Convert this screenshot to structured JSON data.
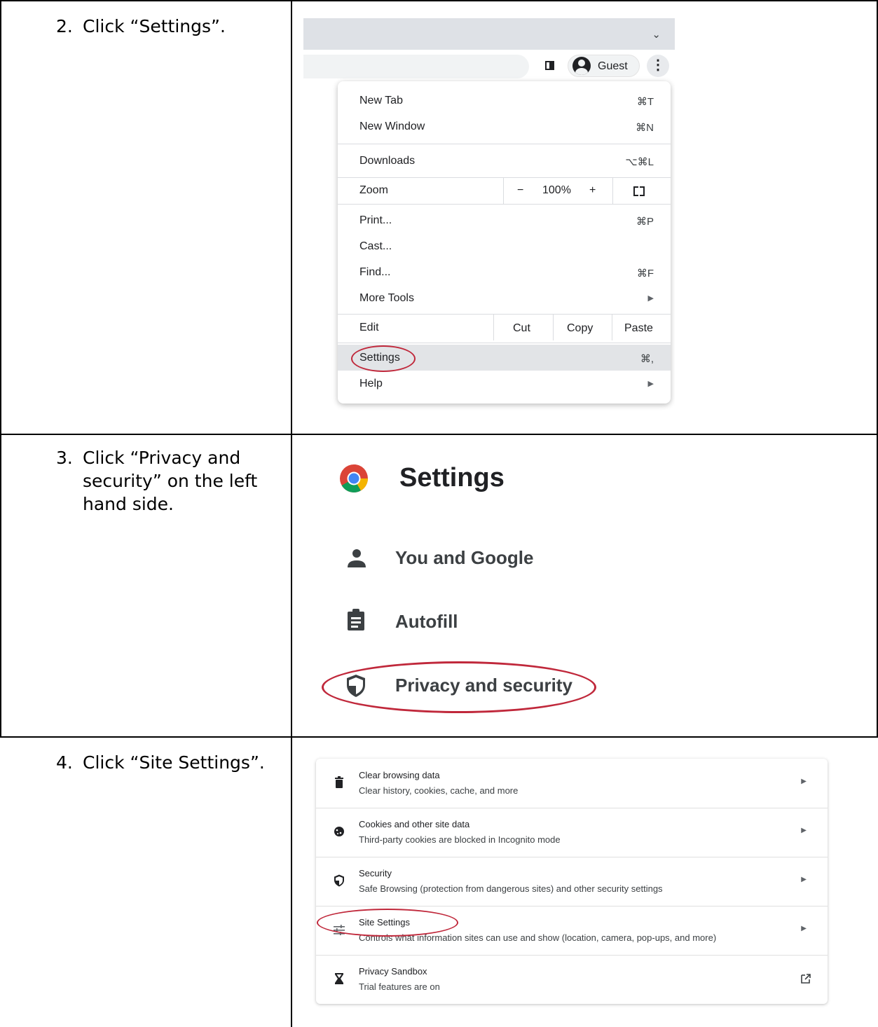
{
  "steps": [
    {
      "number": "2.",
      "text": "Click “Settings”."
    },
    {
      "number": "3.",
      "text": "Click “Privacy and security” on the left hand side."
    },
    {
      "number": "4.",
      "text": "Click “Site Settings”."
    }
  ],
  "chrome": {
    "profile_label": "Guest",
    "chevron_icon": "⌄",
    "more_icon": "⋮"
  },
  "menu": {
    "new_tab": {
      "label": "New Tab",
      "shortcut": "⌘T"
    },
    "new_window": {
      "label": "New Window",
      "shortcut": "⌘N"
    },
    "downloads": {
      "label": "Downloads",
      "shortcut": "⌥⌘L"
    },
    "zoom": {
      "label": "Zoom",
      "minus": "−",
      "value": "100%",
      "plus": "+"
    },
    "print": {
      "label": "Print...",
      "shortcut": "⌘P"
    },
    "cast": {
      "label": "Cast..."
    },
    "find": {
      "label": "Find...",
      "shortcut": "⌘F"
    },
    "more_tools": {
      "label": "More Tools"
    },
    "edit": {
      "label": "Edit",
      "cut": "Cut",
      "copy": "Copy",
      "paste": "Paste"
    },
    "settings": {
      "label": "Settings",
      "shortcut": "⌘,"
    },
    "help": {
      "label": "Help"
    },
    "submenu_arrow": "▶"
  },
  "settings_page": {
    "title": "Settings",
    "nav": [
      {
        "label": "You and Google",
        "icon": "person-icon"
      },
      {
        "label": "Autofill",
        "icon": "clipboard-icon"
      },
      {
        "label": "Privacy and security",
        "icon": "shield-icon"
      }
    ]
  },
  "privacy_card": {
    "arrow": "▶",
    "rows": [
      {
        "title": "Clear browsing data",
        "subtitle": "Clear history, cookies, cache, and more",
        "icon": "trash-icon"
      },
      {
        "title": "Cookies and other site data",
        "subtitle": "Third-party cookies are blocked in Incognito mode",
        "icon": "cookie-icon"
      },
      {
        "title": "Security",
        "subtitle": "Safe Browsing (protection from dangerous sites) and other security settings",
        "icon": "shield-icon"
      },
      {
        "title": "Site Settings",
        "subtitle": "Controls what information sites can use and show (location, camera, pop-ups, and more)",
        "icon": "tune-icon"
      },
      {
        "title": "Privacy Sandbox",
        "subtitle": "Trial features are on",
        "icon": "flask-icon"
      }
    ]
  },
  "colors": {
    "highlight_circle": "#c0283b",
    "menu_selected": "#e2e4e7"
  }
}
